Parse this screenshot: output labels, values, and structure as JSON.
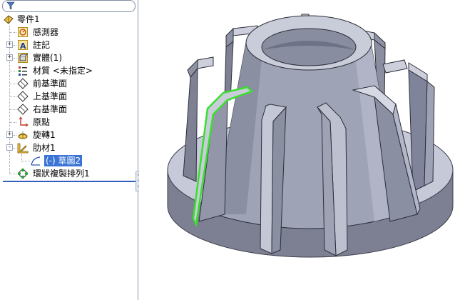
{
  "feature_tree": {
    "filter_icon": "filter-funnel-icon",
    "items": [
      {
        "label": "零件1",
        "icon": "part-icon",
        "expander": ""
      },
      {
        "label": "感測器",
        "icon": "sensor-icon",
        "expander": ""
      },
      {
        "label": "註記",
        "icon": "annotation-icon",
        "expander": "+"
      },
      {
        "label": "實體(1)",
        "icon": "solid-bodies-icon",
        "expander": "+"
      },
      {
        "label": "材質 <未指定>",
        "icon": "material-icon",
        "expander": ""
      },
      {
        "label": "前基準面",
        "icon": "plane-icon",
        "expander": ""
      },
      {
        "label": "上基準面",
        "icon": "plane-icon",
        "expander": ""
      },
      {
        "label": "右基準面",
        "icon": "plane-icon",
        "expander": ""
      },
      {
        "label": "原點",
        "icon": "origin-icon",
        "expander": ""
      },
      {
        "label": "旋轉1",
        "icon": "revolve-icon",
        "expander": "+"
      },
      {
        "label": "肋材1",
        "icon": "rib-icon",
        "expander": "-"
      },
      {
        "label": "(-) 草圖2",
        "icon": "sketch-icon",
        "expander": ""
      },
      {
        "label": "環狀複製排列1",
        "icon": "circular-pattern-icon",
        "expander": ""
      }
    ]
  },
  "viewport": {
    "model": "revolved-part-with-ribs",
    "highlight_color": "#39e02d",
    "body_color": "#9ea3b5"
  }
}
